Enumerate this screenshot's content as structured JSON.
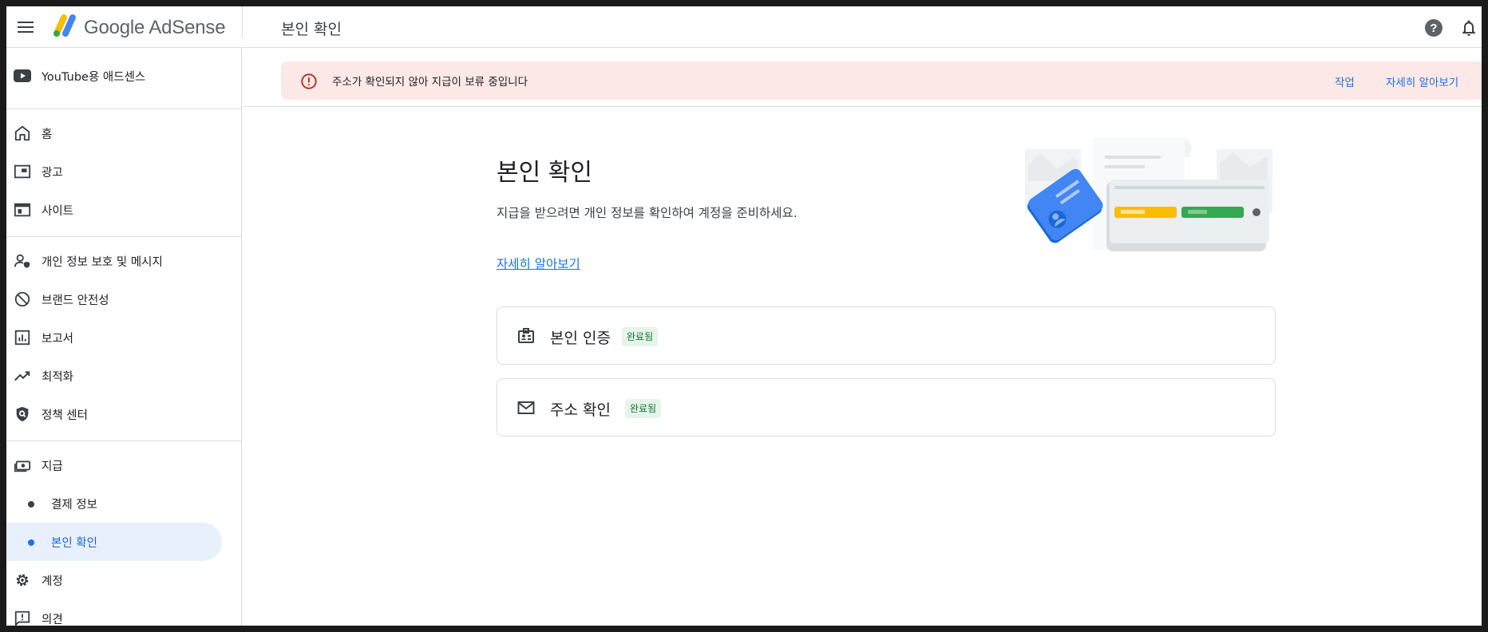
{
  "app": {
    "brand": "Google AdSense",
    "page_title": "본인 확인"
  },
  "sidebar": {
    "youtube": "YouTube용 애드센스",
    "items": [
      {
        "label": "홈",
        "icon": "home-icon"
      },
      {
        "label": "광고",
        "icon": "ads-icon"
      },
      {
        "label": "사이트",
        "icon": "sites-icon"
      },
      {
        "label": "개인 정보 보호 및 메시지",
        "icon": "privacy-icon"
      },
      {
        "label": "브랜드 안전성",
        "icon": "block-icon"
      },
      {
        "label": "보고서",
        "icon": "reports-icon"
      },
      {
        "label": "최적화",
        "icon": "trending-icon"
      },
      {
        "label": "정책 센터",
        "icon": "policy-icon"
      },
      {
        "label": "지급",
        "icon": "payments-icon"
      },
      {
        "label": "결제 정보"
      },
      {
        "label": "본인 확인"
      },
      {
        "label": "계정",
        "icon": "gear-icon"
      },
      {
        "label": "의견",
        "icon": "feedback-icon"
      }
    ]
  },
  "banner": {
    "message": "주소가 확인되지 않아 지급이 보류 중입니다",
    "action": "작업",
    "learn_more": "자세히 알아보기"
  },
  "main": {
    "title": "본인 확인",
    "description": "지급을 받으려면 개인 정보를 확인하여 계정을 준비하세요.",
    "learn_more": "자세히 알아보기",
    "cards": [
      {
        "title": "본인 인증",
        "status": "완료됨",
        "icon": "id-card-icon"
      },
      {
        "title": "주소 확인",
        "status": "완료됨",
        "icon": "mail-icon"
      }
    ]
  },
  "colors": {
    "accent": "#1a73e8",
    "banner_bg": "#fce8e6",
    "error": "#c5221f",
    "success_bg": "#e6f4ea",
    "success_text": "#137333",
    "active_bg": "#e8f0fe"
  }
}
